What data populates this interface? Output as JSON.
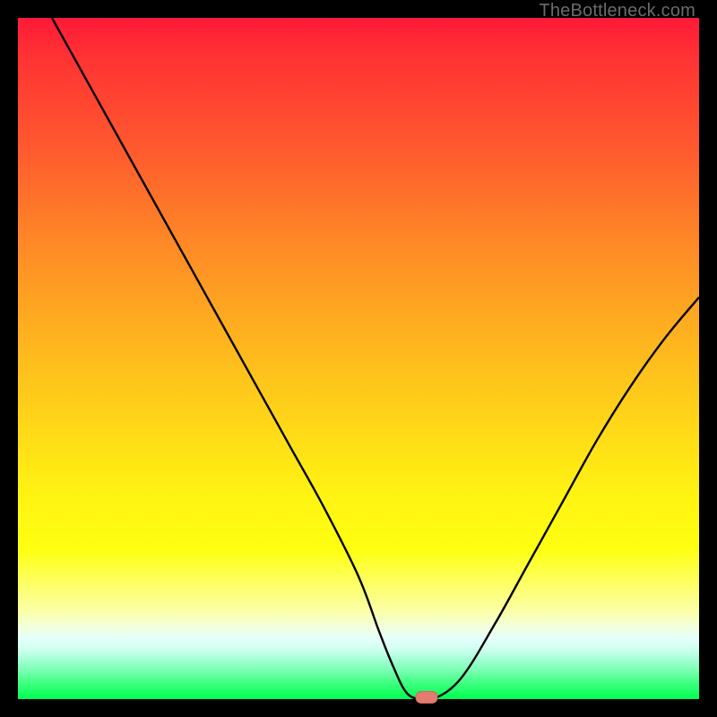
{
  "watermark": "TheBottleneck.com",
  "colors": {
    "background": "#000000",
    "curve": "#000000",
    "marker_fill": "#e37b6f",
    "marker_stroke": "#cf6c60"
  },
  "chart_data": {
    "type": "line",
    "title": "",
    "xlabel": "",
    "ylabel": "",
    "xlim": [
      0,
      100
    ],
    "ylim": [
      0,
      100
    ],
    "x": [
      5,
      10,
      15,
      20,
      25,
      30,
      35,
      40,
      45,
      50,
      53,
      55,
      57,
      59,
      61,
      65,
      70,
      75,
      80,
      85,
      90,
      95,
      100
    ],
    "values": [
      100,
      91,
      82,
      73,
      64,
      55,
      46,
      37,
      28,
      18,
      10,
      5,
      1,
      0,
      0,
      3,
      11,
      20,
      29,
      38,
      46,
      53,
      59
    ],
    "marker": {
      "x": 60,
      "y": 0
    }
  }
}
